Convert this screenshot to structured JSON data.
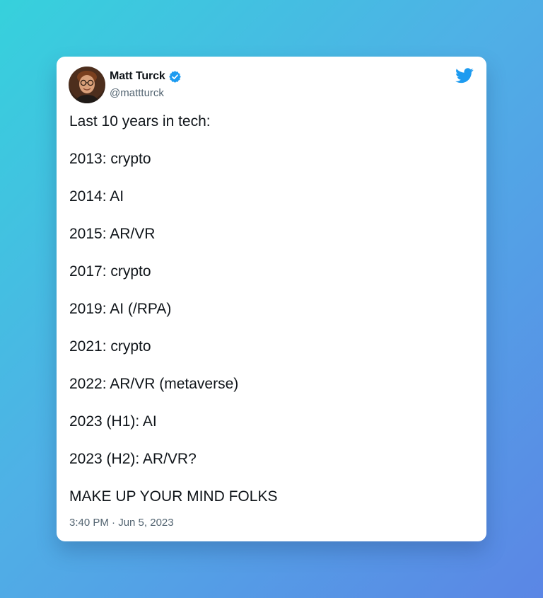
{
  "tweet": {
    "author": {
      "name": "Matt Turck",
      "handle": "@mattturck",
      "verified": true,
      "avatar_icon": "avatar"
    },
    "platform_icon": "twitter-bird-icon",
    "lines": [
      "Last 10 years in tech:",
      "2013: crypto",
      "2014: AI",
      "2015: AR/VR",
      "2017: crypto",
      "2019: AI (/RPA)",
      "2021: crypto",
      "2022: AR/VR (metaverse)",
      "2023 (H1): AI",
      "2023 (H2): AR/VR?",
      "MAKE UP YOUR MIND FOLKS"
    ],
    "timestamp": "3:40 PM · Jun 5, 2023"
  },
  "colors": {
    "background_start": "#36d1dc",
    "background_end": "#5b86e5",
    "card": "#ffffff",
    "text_primary": "#0f1419",
    "text_secondary": "#536471",
    "twitter_blue": "#1d9bf0"
  }
}
